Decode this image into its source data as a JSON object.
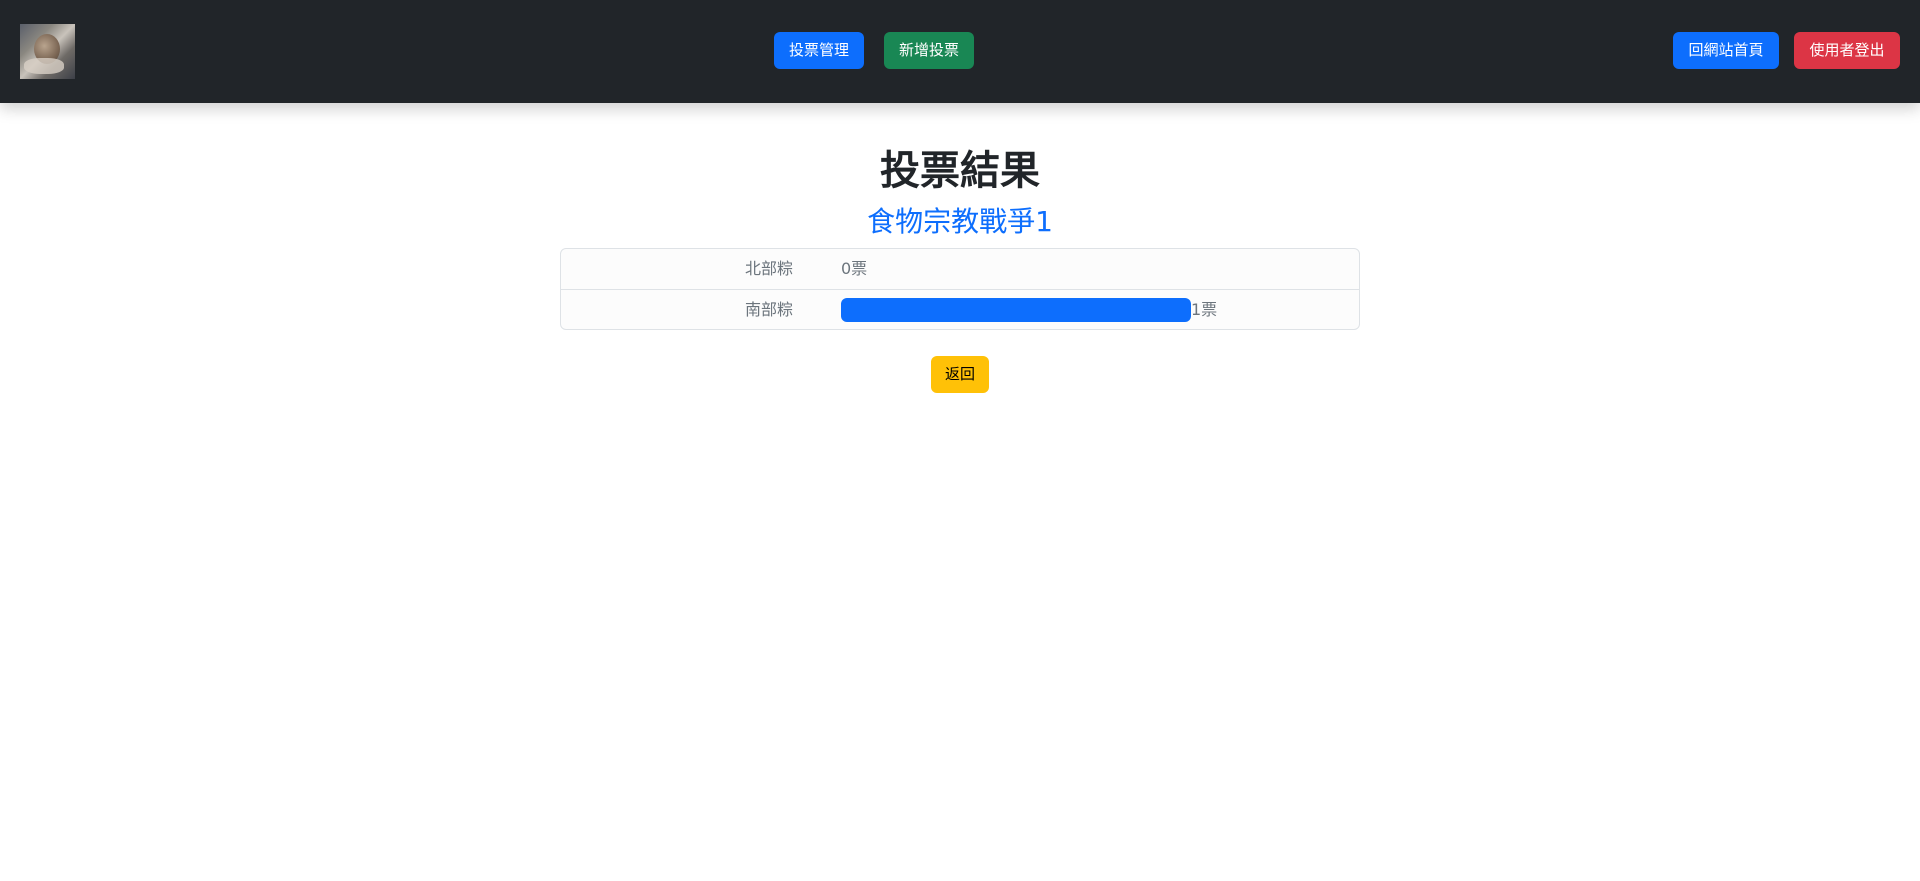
{
  "navbar": {
    "logo_alt": "avatar",
    "manage_label": "投票管理",
    "add_label": "新增投票",
    "home_label": "回網站首頁",
    "logout_label": "使用者登出"
  },
  "page": {
    "title": "投票結果",
    "subtitle": "食物宗教戰爭1",
    "back_label": "返回"
  },
  "results": [
    {
      "option": "北部粽",
      "votes": 0,
      "votes_label": "0票",
      "share": 0
    },
    {
      "option": "南部粽",
      "votes": 1,
      "votes_label": "1票",
      "share": 1
    }
  ],
  "colors": {
    "navbar_bg": "#212529",
    "primary": "#0d6efd",
    "success": "#198754",
    "danger": "#dc3545",
    "warning": "#ffc107"
  }
}
